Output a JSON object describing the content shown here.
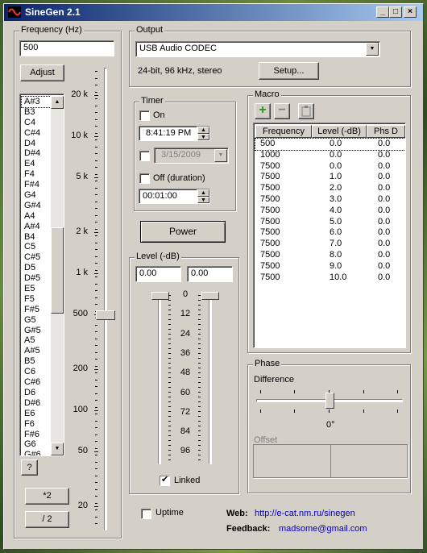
{
  "window": {
    "title": "SineGen 2.1",
    "minimize": "_",
    "maximize": "□",
    "close": "×"
  },
  "frequency": {
    "group_label": "Frequency (Hz)",
    "value": "500",
    "adjust_label": "Adjust",
    "notes": [
      "A#3",
      "B3",
      "C4",
      "C#4",
      "D4",
      "D#4",
      "E4",
      "F4",
      "F#4",
      "G4",
      "G#4",
      "A4",
      "A#4",
      "B4",
      "C5",
      "C#5",
      "D5",
      "D#5",
      "E5",
      "F5",
      "F#5",
      "G5",
      "G#5",
      "A5",
      "A#5",
      "B5",
      "C6",
      "C#6",
      "D6",
      "D#6",
      "E6",
      "F6",
      "F#6",
      "G6",
      "G#6"
    ],
    "help_label": "?",
    "times2_label": "*2",
    "div2_label": "/ 2",
    "scale": [
      "20 k",
      "10 k",
      "5 k",
      "2 k",
      "1 k",
      "500",
      "200",
      "100",
      "50",
      "20"
    ]
  },
  "output": {
    "group_label": "Output",
    "device": "USB Audio CODEC",
    "format": "24-bit, 96 kHz, stereo",
    "setup_label": "Setup..."
  },
  "timer": {
    "group_label": "Timer",
    "on_label": "On",
    "time": "8:41:19 PM",
    "date": "3/15/2009",
    "off_label": "Off (duration)",
    "duration": "00:01:00"
  },
  "power_label": "Power",
  "level": {
    "group_label": "Level (-dB)",
    "left": "0.00",
    "right": "0.00",
    "scale": [
      "0",
      "12",
      "24",
      "36",
      "48",
      "60",
      "72",
      "84",
      "96"
    ],
    "linked_label": "Linked",
    "linked_checked": true
  },
  "macro": {
    "group_label": "Macro",
    "add_icon": "plus-icon",
    "remove_icon": "minus-icon",
    "paste_icon": "clipboard-icon",
    "columns": [
      "Frequency",
      "Level (-dB)",
      "Phs D"
    ],
    "rows": [
      [
        "500",
        "0.0",
        "0.0"
      ],
      [
        "1000",
        "0.0",
        "0.0"
      ],
      [
        "7500",
        "0.0",
        "0.0"
      ],
      [
        "7500",
        "1.0",
        "0.0"
      ],
      [
        "7500",
        "2.0",
        "0.0"
      ],
      [
        "7500",
        "3.0",
        "0.0"
      ],
      [
        "7500",
        "4.0",
        "0.0"
      ],
      [
        "7500",
        "5.0",
        "0.0"
      ],
      [
        "7500",
        "6.0",
        "0.0"
      ],
      [
        "7500",
        "7.0",
        "0.0"
      ],
      [
        "7500",
        "8.0",
        "0.0"
      ],
      [
        "7500",
        "9.0",
        "0.0"
      ],
      [
        "7500",
        "10.0",
        "0.0"
      ]
    ]
  },
  "phase": {
    "group_label": "Phase",
    "difference_label": "Difference",
    "value": "0°",
    "offset_label": "Offset"
  },
  "uptime_label": "Uptime",
  "web_label": "Web:",
  "web_url": "http://e-cat.nm.ru/sinegen",
  "feedback_label": "Feedback:",
  "feedback_email": "madsome@gmail.com"
}
